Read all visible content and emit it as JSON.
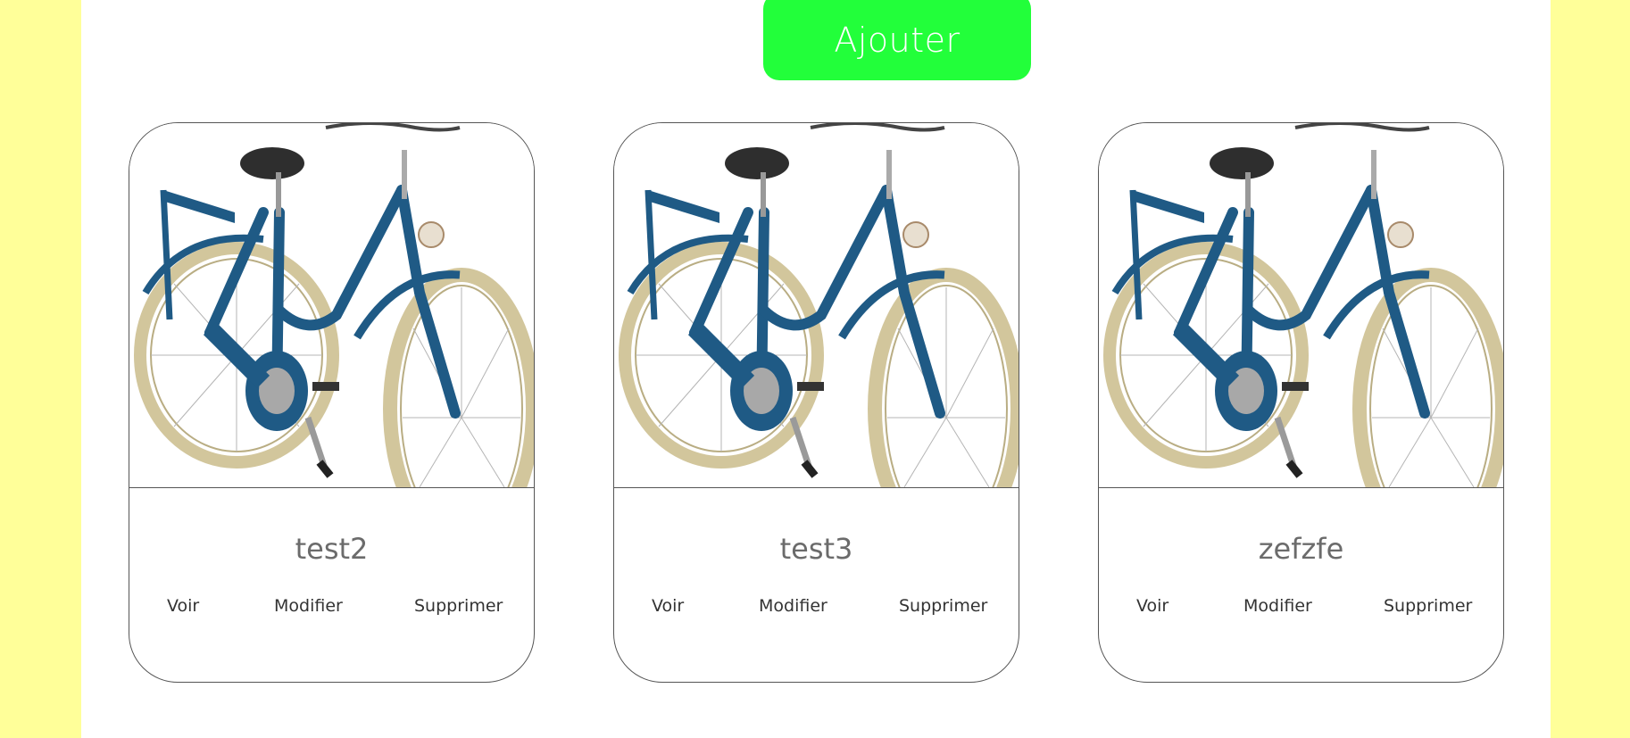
{
  "colors": {
    "background": "#ffff99",
    "panel": "#ffffff",
    "add_button": "#22ff3a",
    "bike_frame": "#1f5a85",
    "tire": "#d2c69c"
  },
  "header": {
    "add_label": "Ajouter"
  },
  "cards": [
    {
      "title": "test2",
      "view_label": "Voir",
      "edit_label": "Modifier",
      "delete_label": "Supprimer"
    },
    {
      "title": "test3",
      "view_label": "Voir",
      "edit_label": "Modifier",
      "delete_label": "Supprimer"
    },
    {
      "title": "zefzfe",
      "view_label": "Voir",
      "edit_label": "Modifier",
      "delete_label": "Supprimer"
    }
  ]
}
